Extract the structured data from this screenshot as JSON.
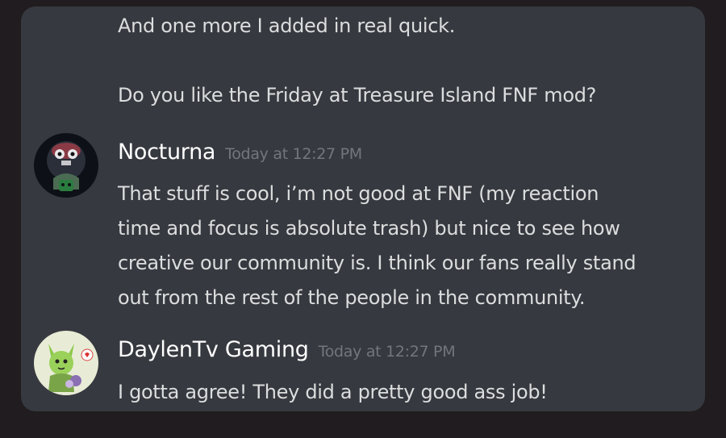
{
  "continuation": {
    "lines": [
      "And one more I added in real quick.",
      "",
      "Do you like the Friday at Treasure Island FNF mod?"
    ]
  },
  "messages": [
    {
      "username": "Nocturna",
      "timestamp": "Today at 12:27 PM",
      "avatar_icon": "nocturna-avatar",
      "lines": [
        "That stuff is cool, i’m not good at FNF (my reaction",
        "time and focus is absolute trash) but nice to see how",
        "creative our community is. I think our fans really stand",
        "out from the rest of the people in the community."
      ]
    },
    {
      "username": "DaylenTv Gaming",
      "timestamp": "Today at 12:27 PM",
      "avatar_icon": "daylentv-avatar",
      "lines": [
        "I gotta agree! They did a pretty good ass job!"
      ]
    }
  ],
  "colors": {
    "background": "#201c1f",
    "card": "#36393f",
    "text": "#dcddde",
    "username": "#ffffff",
    "timestamp": "#72767d"
  }
}
